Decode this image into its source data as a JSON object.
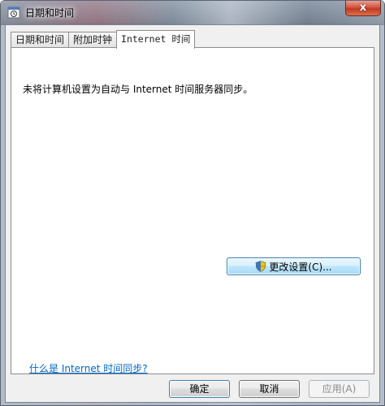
{
  "window": {
    "title": "日期和时间",
    "close_label": "x"
  },
  "tabs": [
    {
      "label": "日期和时间",
      "active": false
    },
    {
      "label": "附加时钟",
      "active": false
    },
    {
      "label": "Internet 时间",
      "active": true
    }
  ],
  "panel": {
    "status_text": "未将计算机设置为自动与 Internet 时间服务器同步。",
    "change_settings_label": "更改设置(C)...",
    "help_link": "什么是 Internet 时间同步?"
  },
  "buttons": {
    "ok": "确定",
    "cancel": "取消",
    "apply": "应用(A)"
  },
  "colors": {
    "link": "#0066cc",
    "focus_border": "#3c7fb1",
    "close_button": "#c23a23"
  }
}
